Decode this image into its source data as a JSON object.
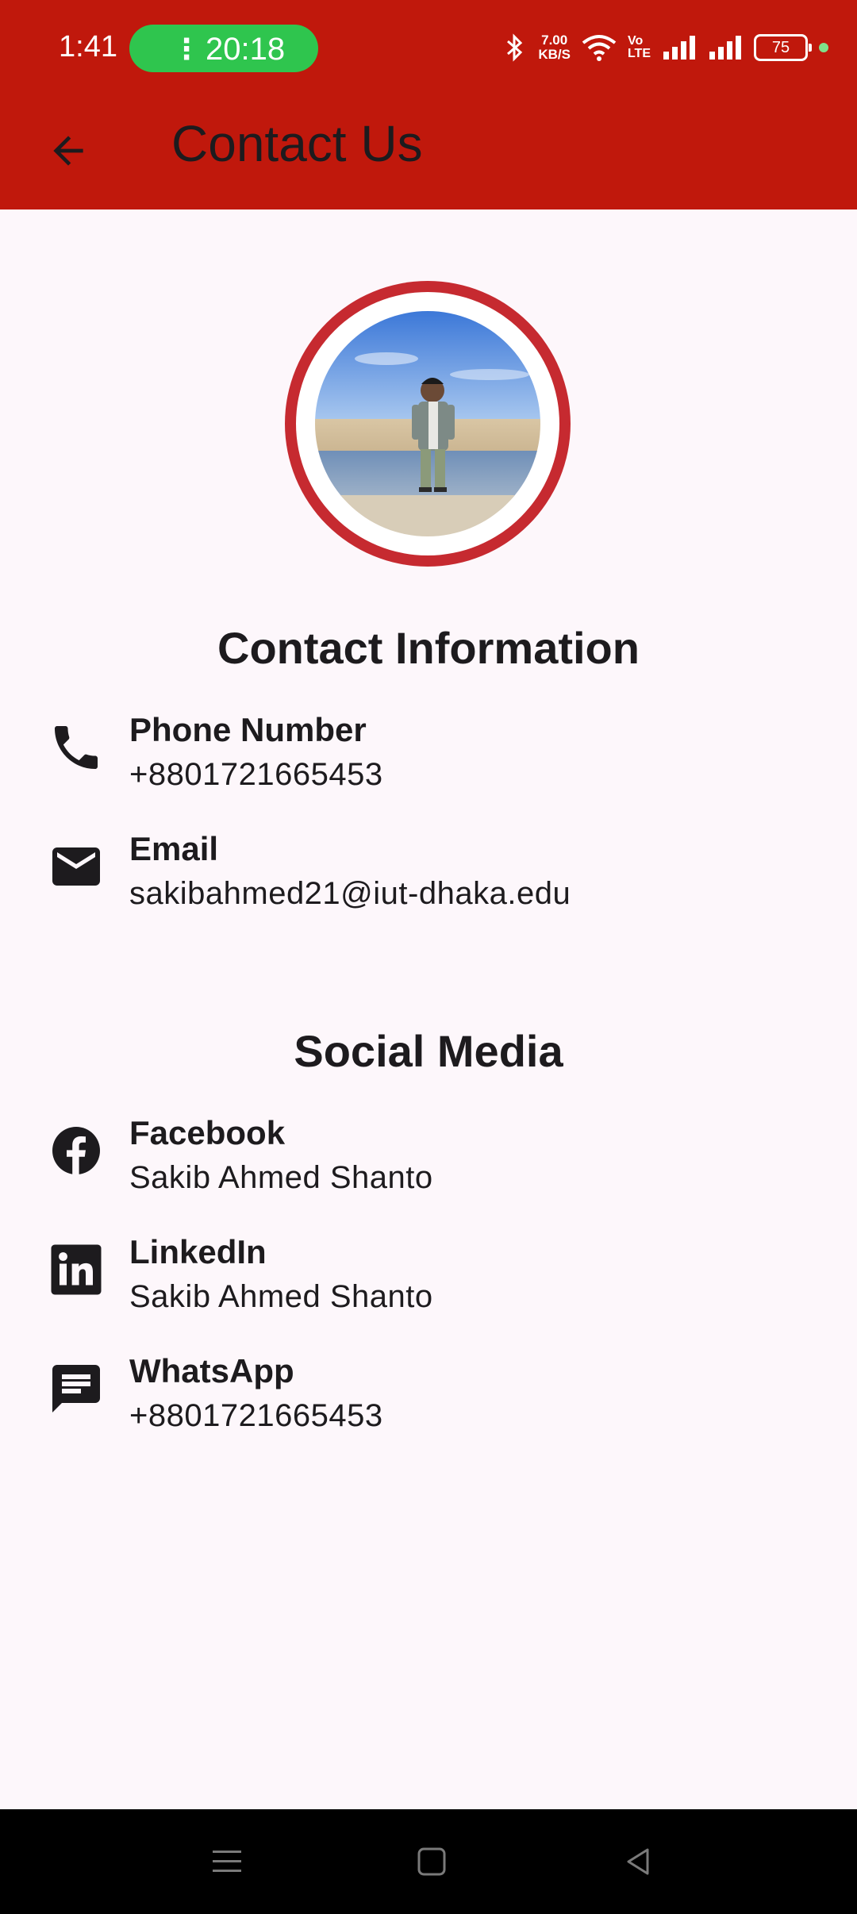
{
  "status_bar": {
    "time": "1:41",
    "call_dots": "⋮",
    "call_timer": "20:18",
    "net_speed": "7.00",
    "net_unit": "KB/S",
    "volte_top": "Vo",
    "volte_bottom": "LTE",
    "battery": "75"
  },
  "app_bar": {
    "title": "Contact Us"
  },
  "contact_section": {
    "heading": "Contact Information",
    "items": [
      {
        "label": "Phone Number",
        "value": "+8801721665453",
        "icon": "phone-icon"
      },
      {
        "label": "Email",
        "value": "sakibahmed21@iut-dhaka.edu",
        "icon": "mail-icon"
      }
    ]
  },
  "social_section": {
    "heading": "Social Media",
    "items": [
      {
        "label": "Facebook",
        "value": "Sakib Ahmed Shanto",
        "icon": "facebook-icon"
      },
      {
        "label": "LinkedIn",
        "value": "Sakib Ahmed Shanto",
        "icon": "linkedin-icon"
      },
      {
        "label": "WhatsApp",
        "value": "+8801721665453",
        "icon": "chat-icon"
      }
    ]
  },
  "colors": {
    "app_bar": "#c0180c",
    "avatar_ring": "#c62a30",
    "background": "#fdf7fb",
    "call_pill": "#2fc54e"
  }
}
